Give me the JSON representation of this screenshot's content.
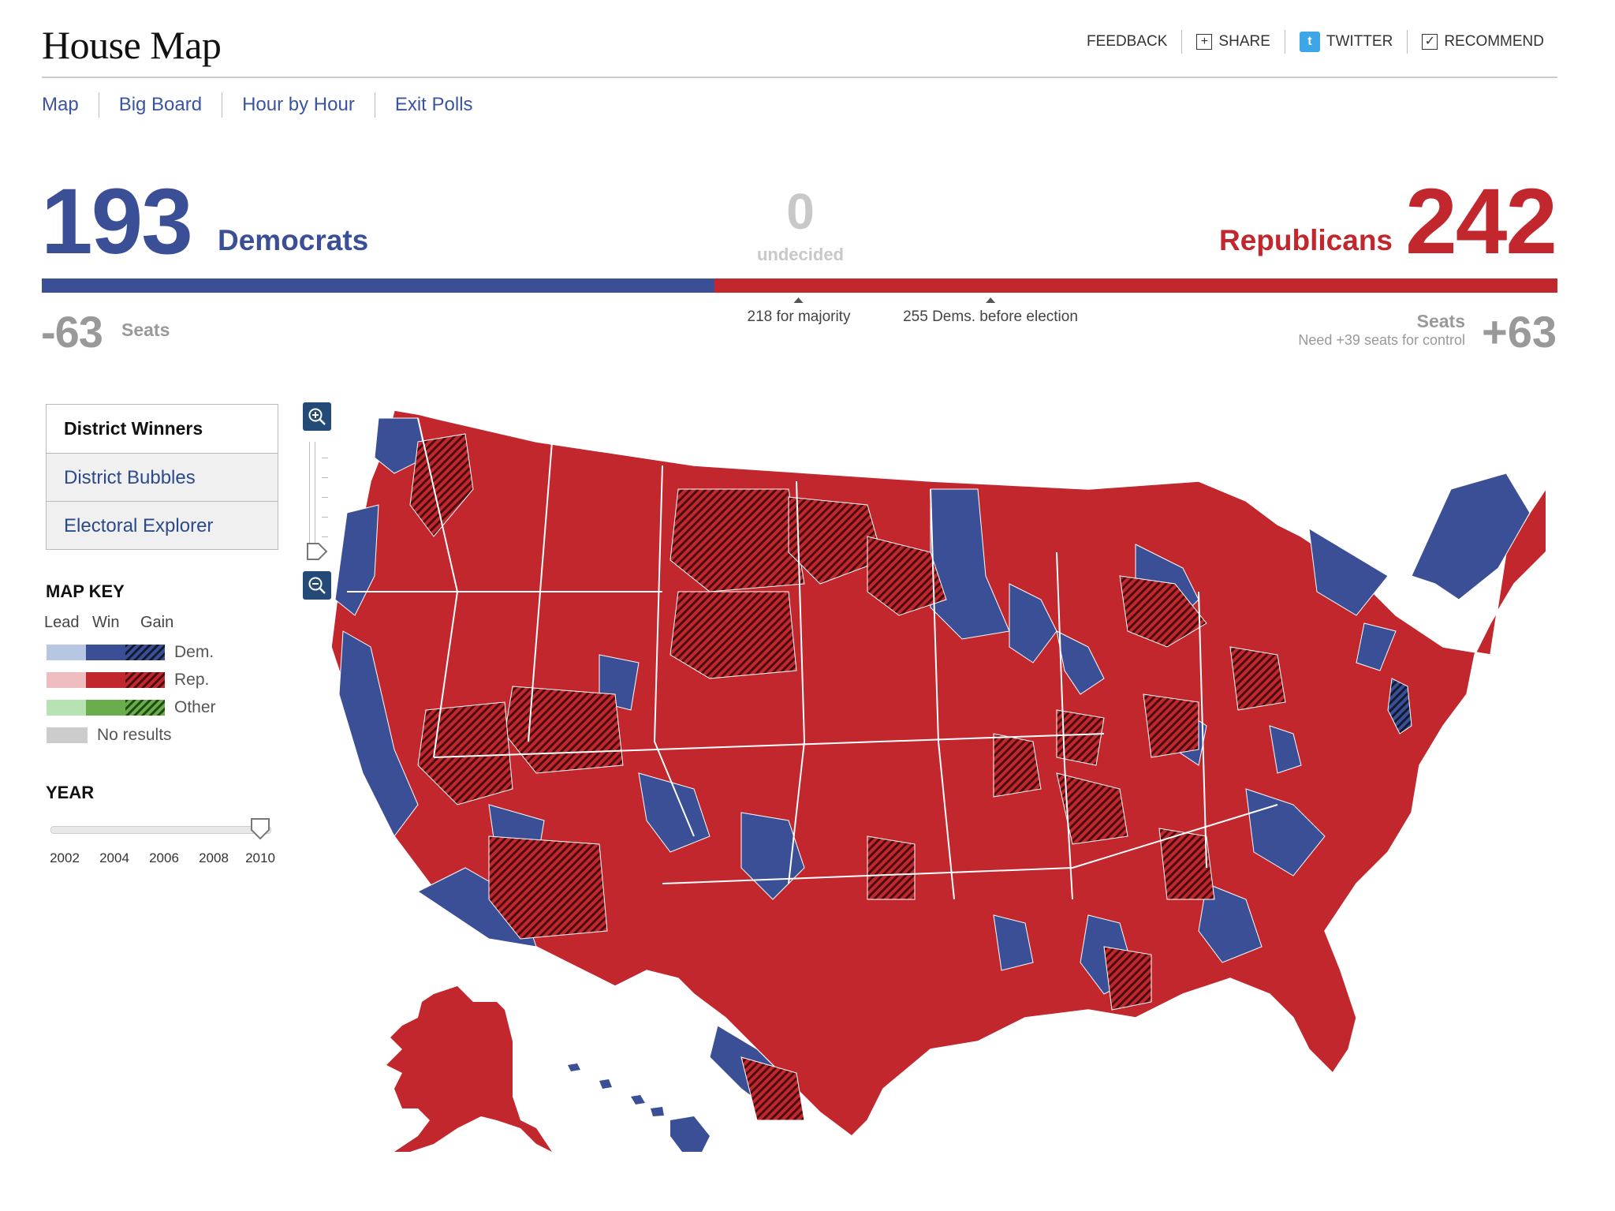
{
  "header": {
    "title": "House Map",
    "utilities": [
      {
        "label": "FEEDBACK",
        "icon": ""
      },
      {
        "label": "SHARE",
        "icon": "plus-box-icon"
      },
      {
        "label": "TWITTER",
        "icon": "twitter-icon"
      },
      {
        "label": "RECOMMEND",
        "icon": "checkbox-icon"
      }
    ]
  },
  "nav": {
    "tabs": [
      "Map",
      "Big Board",
      "Hour by Hour",
      "Exit Polls"
    ]
  },
  "scoreboard": {
    "dem_seats": "193",
    "dem_label": "Democrats",
    "undecided_count": "0",
    "undecided_label": "undecided",
    "rep_seats": "242",
    "rep_label": "Republicans",
    "dem_share": 0.4437,
    "majority_marker": "218 for majority",
    "before_marker": "255 Dems. before election",
    "dem_change": "-63",
    "dem_change_label": "Seats",
    "rep_change": "+63",
    "rep_change_label": "Seats",
    "rep_note": "Need +39 seats for control",
    "colors": {
      "dem": "#3b4f96",
      "rep": "#c1272d",
      "undecided": "#c8c8c8"
    }
  },
  "views": {
    "items": [
      "District Winners",
      "District Bubbles",
      "Electoral Explorer"
    ],
    "selected": "District Winners"
  },
  "map_key": {
    "title": "MAP KEY",
    "columns": [
      "Lead",
      "Win",
      "Gain"
    ],
    "rows": [
      {
        "label": "Dem.",
        "colors": [
          "#b7c6e3",
          "#3b4f96",
          "#1e2f5a"
        ]
      },
      {
        "label": "Rep.",
        "colors": [
          "#efbcbf",
          "#c1272d",
          "#6e1618"
        ]
      },
      {
        "label": "Other",
        "colors": [
          "#b7e3b2",
          "#6aad4c",
          "#2d6a1c"
        ]
      }
    ],
    "no_results": "No results",
    "no_results_color": "#cccccc"
  },
  "year": {
    "title": "YEAR",
    "options": [
      "2002",
      "2004",
      "2006",
      "2008",
      "2010"
    ],
    "selected": "2010"
  },
  "zoom": {
    "in_icon": "zoom-in-icon",
    "out_icon": "zoom-out-icon"
  }
}
